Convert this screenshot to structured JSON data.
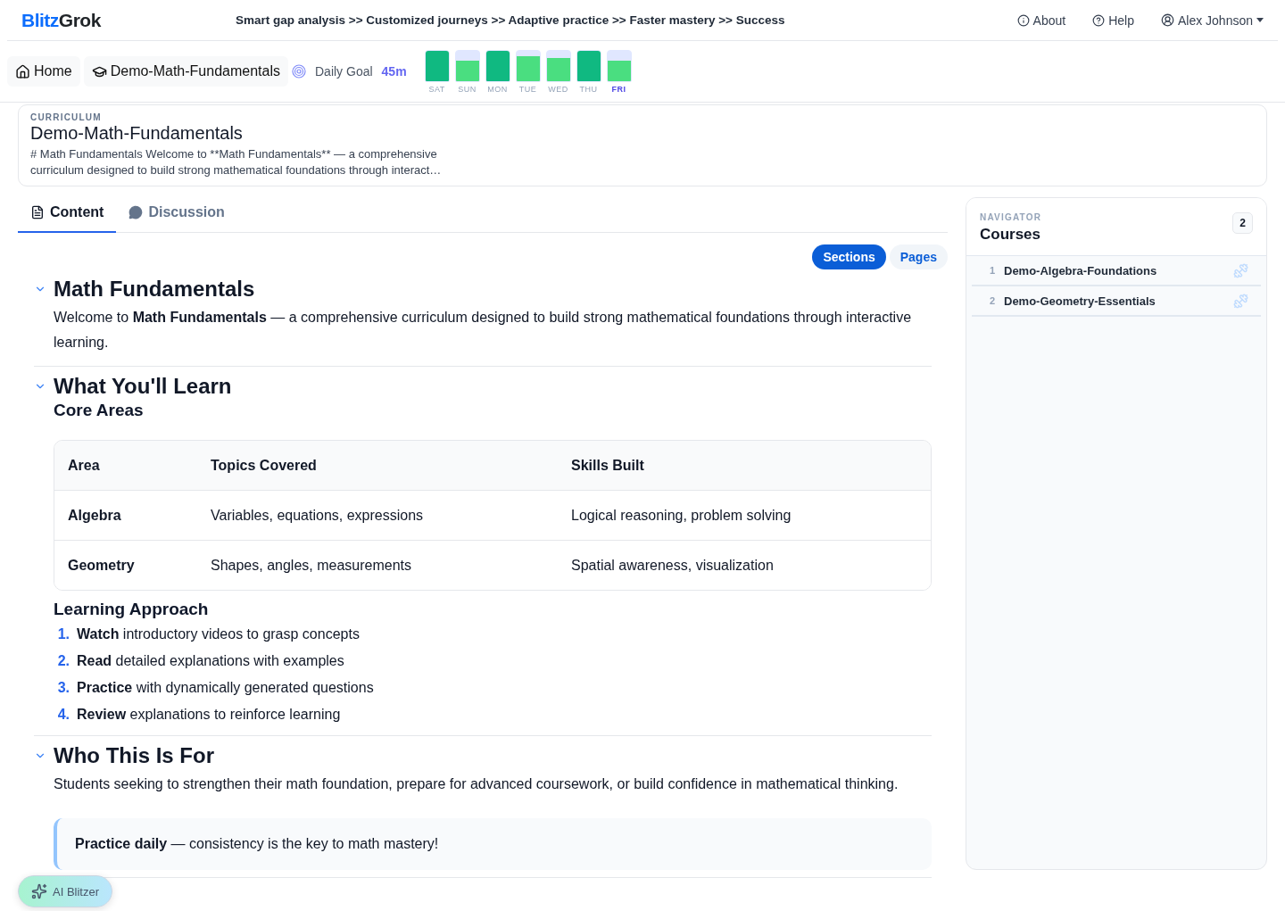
{
  "header": {
    "logo": {
      "part1": "Blitz",
      "part2": "Grok"
    },
    "tagline": "Smart gap analysis >> Customized journeys >> Adaptive practice >> Faster mastery >> Success",
    "links": [
      "About",
      "Help"
    ],
    "user": "Alex Johnson"
  },
  "subbar": {
    "home": "Home",
    "course": "Demo-Math-Fundamentals",
    "goal_label": "Daily Goal",
    "goal_value": "45m",
    "days": [
      {
        "label": "SAT",
        "level": 1,
        "selected": false
      },
      {
        "label": "SUN",
        "level": 0.65,
        "selected": false
      },
      {
        "label": "MON",
        "level": 1,
        "selected": false
      },
      {
        "label": "TUE",
        "level": 0.8,
        "selected": false
      },
      {
        "label": "WED",
        "level": 0.75,
        "selected": false
      },
      {
        "label": "THU",
        "level": 1,
        "selected": false
      },
      {
        "label": "FRI",
        "level": 0.65,
        "selected": true
      }
    ]
  },
  "curriculum": {
    "eyebrow": "CURRICULUM",
    "title": "Demo-Math-Fundamentals",
    "description": "# Math Fundamentals Welcome to **Math Fundamentals** — a comprehensive curriculum designed to build strong mathematical foundations through interact…"
  },
  "tabs": [
    {
      "label": "Content",
      "selected": true
    },
    {
      "label": "Discussion",
      "selected": false
    }
  ],
  "view_toggle": [
    {
      "label": "Sections",
      "selected": true
    },
    {
      "label": "Pages",
      "selected": false
    }
  ],
  "sections": [
    {
      "title": "Math Fundamentals",
      "expanded": true,
      "blocks": [
        {
          "kind": "paragraph",
          "text": "Welcome to **Math Fundamentals** — a comprehensive curriculum designed to build strong mathematical foundations through interactive learning."
        }
      ]
    },
    {
      "title": "What You'll Learn",
      "expanded": true,
      "blocks": [
        {
          "kind": "subheading",
          "text": "Core Areas"
        },
        {
          "kind": "table",
          "columns": [
            "Area",
            "Topics Covered",
            "Skills Built"
          ],
          "rows": [
            [
              "Algebra",
              "Variables, equations, expressions",
              "Logical reasoning, problem solving"
            ],
            [
              "Geometry",
              "Shapes, angles, measurements",
              "Spatial awareness, visualization"
            ]
          ]
        },
        {
          "kind": "subheading",
          "text": "Learning Approach"
        },
        {
          "kind": "list",
          "items": [
            {
              "number": "1.",
              "text": "**Watch** introductory videos to grasp concepts"
            },
            {
              "number": "2.",
              "text": "**Read** detailed explanations with examples"
            },
            {
              "number": "3.",
              "text": "**Practice** with dynamically generated questions"
            },
            {
              "number": "4.",
              "text": "**Review** explanations to reinforce learning"
            }
          ]
        }
      ]
    },
    {
      "title": "Who This Is For",
      "expanded": true,
      "blocks": [
        {
          "kind": "paragraph",
          "text": "Students seeking to strengthen their math foundation, prepare for advanced coursework, or build confidence in mathematical thinking."
        },
        {
          "kind": "callout",
          "text": "**Practice daily** — consistency is the key to math mastery!"
        }
      ]
    }
  ],
  "navigator": {
    "eyebrow": "NAVIGATOR",
    "title": "Courses",
    "count": "2",
    "items": [
      {
        "number": "1",
        "label": "Demo-Algebra-Foundations"
      },
      {
        "number": "2",
        "label": "Demo-Geometry-Essentials"
      }
    ]
  },
  "assistant": {
    "label": "AI Blitzer"
  }
}
